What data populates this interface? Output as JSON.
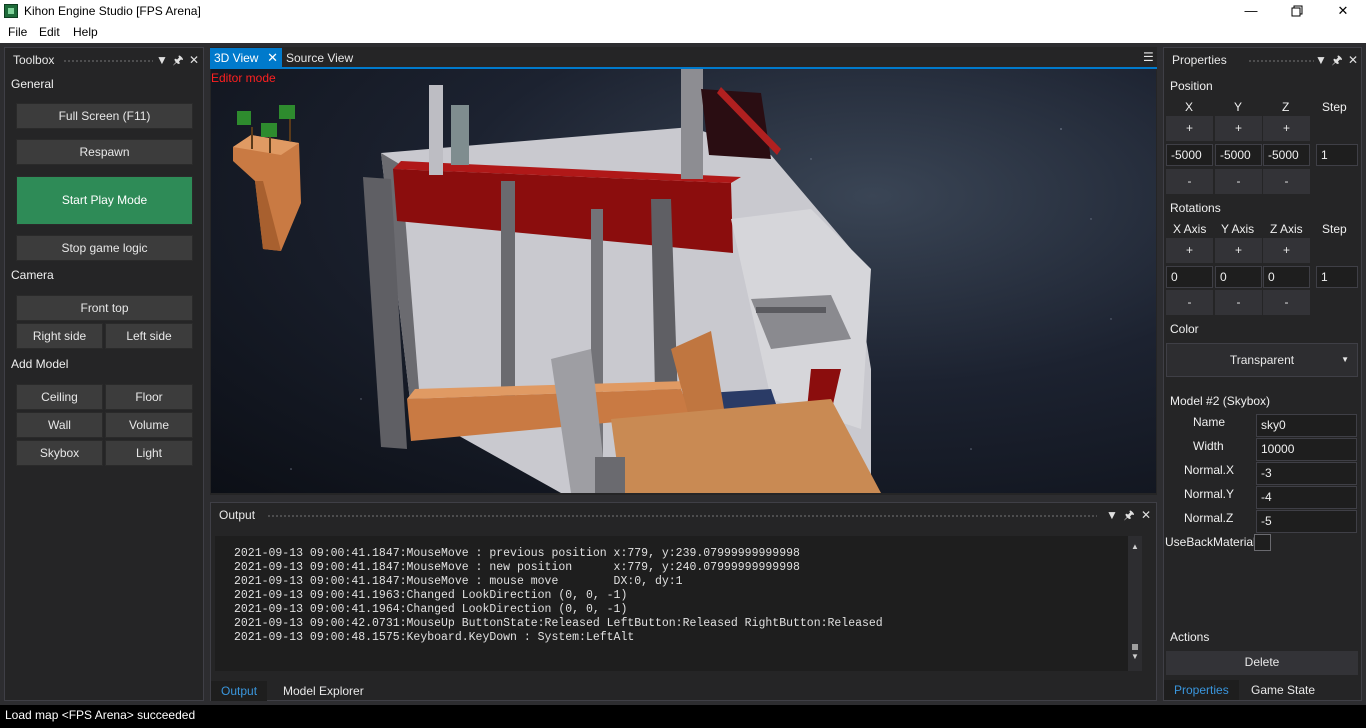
{
  "window": {
    "title": "Kihon Engine Studio [FPS Arena]",
    "minimize_icon": "minimize-icon",
    "restore_icon": "restore-icon",
    "close_icon": "close-icon"
  },
  "menu": [
    "File",
    "Edit",
    "Help"
  ],
  "toolbox": {
    "title": "Toolbox",
    "sections": {
      "general": "General",
      "camera": "Camera",
      "add_model": "Add Model"
    },
    "general_buttons": [
      "Full Screen (F11)",
      "Respawn",
      "Start Play Mode",
      "Stop game logic"
    ],
    "camera_buttons": [
      "Front top",
      "Right side",
      "Left side"
    ],
    "model_buttons": [
      "Ceiling",
      "Floor",
      "Wall",
      "Volume",
      "Skybox",
      "Light"
    ]
  },
  "document": {
    "tabs": [
      "3D View",
      "Source View"
    ],
    "active_tab": "3D View",
    "mode_label": "Editor mode"
  },
  "output": {
    "title": "Output",
    "lines": [
      "2021-09-13 09:00:41.1847:MouseMove : previous position x:779, y:239.07999999999998",
      "2021-09-13 09:00:41.1847:MouseMove : new position      x:779, y:240.07999999999998",
      "2021-09-13 09:00:41.1847:MouseMove : mouse move        DX:0, dy:1",
      "2021-09-13 09:00:41.1963:Changed LookDirection (0, 0, -1)",
      "2021-09-13 09:00:41.1964:Changed LookDirection (0, 0, -1)",
      "2021-09-13 09:00:42.0731:MouseUp ButtonState:Released LeftButton:Released RightButton:Released",
      "2021-09-13 09:00:48.1575:Keyboard.KeyDown : System:LeftAlt"
    ],
    "tabs": [
      "Output",
      "Model Explorer"
    ],
    "active_tab": "Output"
  },
  "properties": {
    "title": "Properties",
    "position": {
      "label": "Position",
      "axes": [
        "X",
        "Y",
        "Z"
      ],
      "step_label": "Step",
      "plus": "+",
      "minus": "-",
      "values": [
        "-5000",
        "-5000",
        "-5000"
      ],
      "step": "1"
    },
    "rotations": {
      "label": "Rotations",
      "axes": [
        "X Axis",
        "Y Axis",
        "Z Axis"
      ],
      "step_label": "Step",
      "plus": "+",
      "minus": "-",
      "values": [
        "0",
        "0",
        "0"
      ],
      "step": "1"
    },
    "color": {
      "label": "Color",
      "selected": "Transparent"
    },
    "model": {
      "header": "Model #2 (Skybox)",
      "fields": [
        {
          "label": "Name",
          "value": "sky0"
        },
        {
          "label": "Width",
          "value": "10000"
        },
        {
          "label": "Normal.X",
          "value": "-3"
        },
        {
          "label": "Normal.Y",
          "value": "-4"
        },
        {
          "label": "Normal.Z",
          "value": "-5"
        }
      ],
      "use_back_material_label": "UseBackMaterial",
      "use_back_material": false
    },
    "actions": {
      "label": "Actions",
      "delete": "Delete"
    },
    "tabs": [
      "Properties",
      "Game State"
    ],
    "active_tab": "Properties"
  },
  "status": {
    "text": "Load map <FPS Arena> succeeded"
  }
}
